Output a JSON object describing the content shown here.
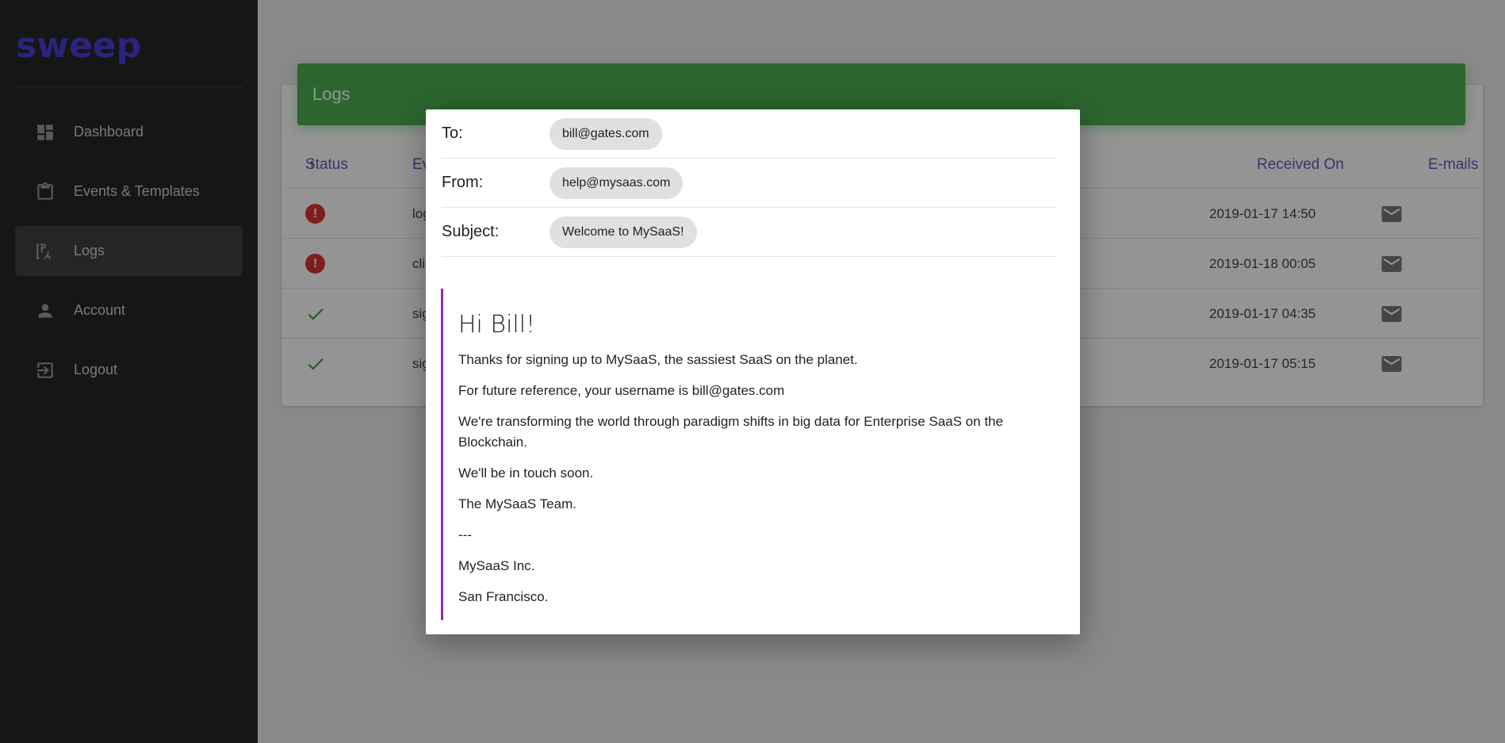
{
  "app": {
    "logo": "sweep"
  },
  "sidebar": {
    "items": [
      {
        "label": "Dashboard",
        "icon": "dashboard-icon"
      },
      {
        "label": "Events & Templates",
        "icon": "clipboard-icon"
      },
      {
        "label": "Logs",
        "icon": "logs-icon",
        "active": true
      },
      {
        "label": "Account",
        "icon": "person-icon"
      },
      {
        "label": "Logout",
        "icon": "logout-icon"
      }
    ]
  },
  "logs": {
    "title": "Logs",
    "columns": {
      "status": "Status",
      "status_sort": "↑",
      "event": "Ev",
      "received": "Received On",
      "emails": "E-mails"
    },
    "rows": [
      {
        "status": "error",
        "event": "log",
        "received": "2019-01-17 14:50"
      },
      {
        "status": "error",
        "event": "cli",
        "received": "2019-01-18 00:05"
      },
      {
        "status": "success",
        "event": "sig",
        "received": "2019-01-17 04:35"
      },
      {
        "status": "success",
        "event": "sig",
        "received": "2019-01-17 05:15"
      }
    ],
    "colors": {
      "header": "#4caf50",
      "error": "#d9352c",
      "success": "#43a047",
      "column_header": "#5a5fbf"
    }
  },
  "email": {
    "to_label": "To:",
    "to": "bill@gates.com",
    "from_label": "From:",
    "from": "help@mysaas.com",
    "subject_label": "Subject:",
    "subject": "Welcome to MySaaS!",
    "greeting": "Hi Bill!",
    "paragraphs": [
      "Thanks for signing up to MySaaS, the sassiest SaaS on the planet.",
      "For future reference, your username is bill@gates.com",
      "We're transforming the world through paradigm shifts in big data for Enterprise SaaS on the Blockchain.",
      "We'll be in touch soon.",
      "The MySaaS Team.",
      "---",
      "MySaaS Inc.",
      "San Francisco."
    ],
    "accent": "#9c27b0"
  }
}
